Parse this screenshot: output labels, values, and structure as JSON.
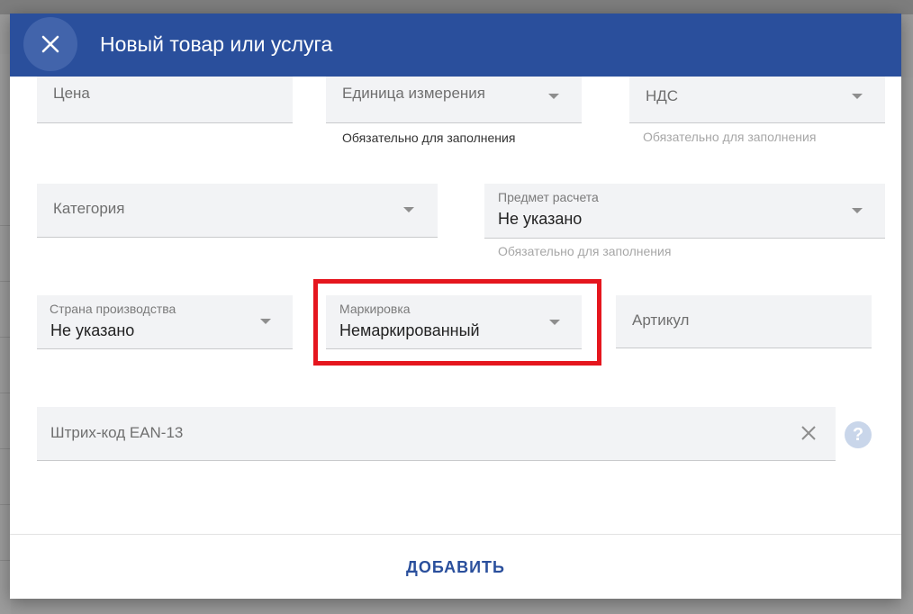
{
  "dialog": {
    "title": "Новый товар или услуга",
    "close_icon": "close-icon",
    "add_label": "ДОБАВИТЬ"
  },
  "fields": {
    "price": {
      "placeholder": "Цена"
    },
    "unit": {
      "placeholder": "Единица измерения",
      "hint": "Обязательно для заполнения"
    },
    "vat": {
      "placeholder": "НДС",
      "hint": "Обязательно для заполнения"
    },
    "category": {
      "placeholder": "Категория"
    },
    "payment_subject": {
      "label": "Предмет расчета",
      "value": "Не указано",
      "hint": "Обязательно для заполнения"
    },
    "country": {
      "label": "Страна производства",
      "value": "Не указано"
    },
    "marking": {
      "label": "Маркировка",
      "value": "Немаркированный"
    },
    "article": {
      "placeholder": "Артикул"
    },
    "barcode": {
      "placeholder": "Штрих-код EAN-13",
      "clear_icon": "clear-icon",
      "help_icon": "help-icon"
    }
  },
  "colors": {
    "header": "#2a4f9c",
    "highlight": "#e5161e",
    "field_bg": "#f2f3f5"
  }
}
